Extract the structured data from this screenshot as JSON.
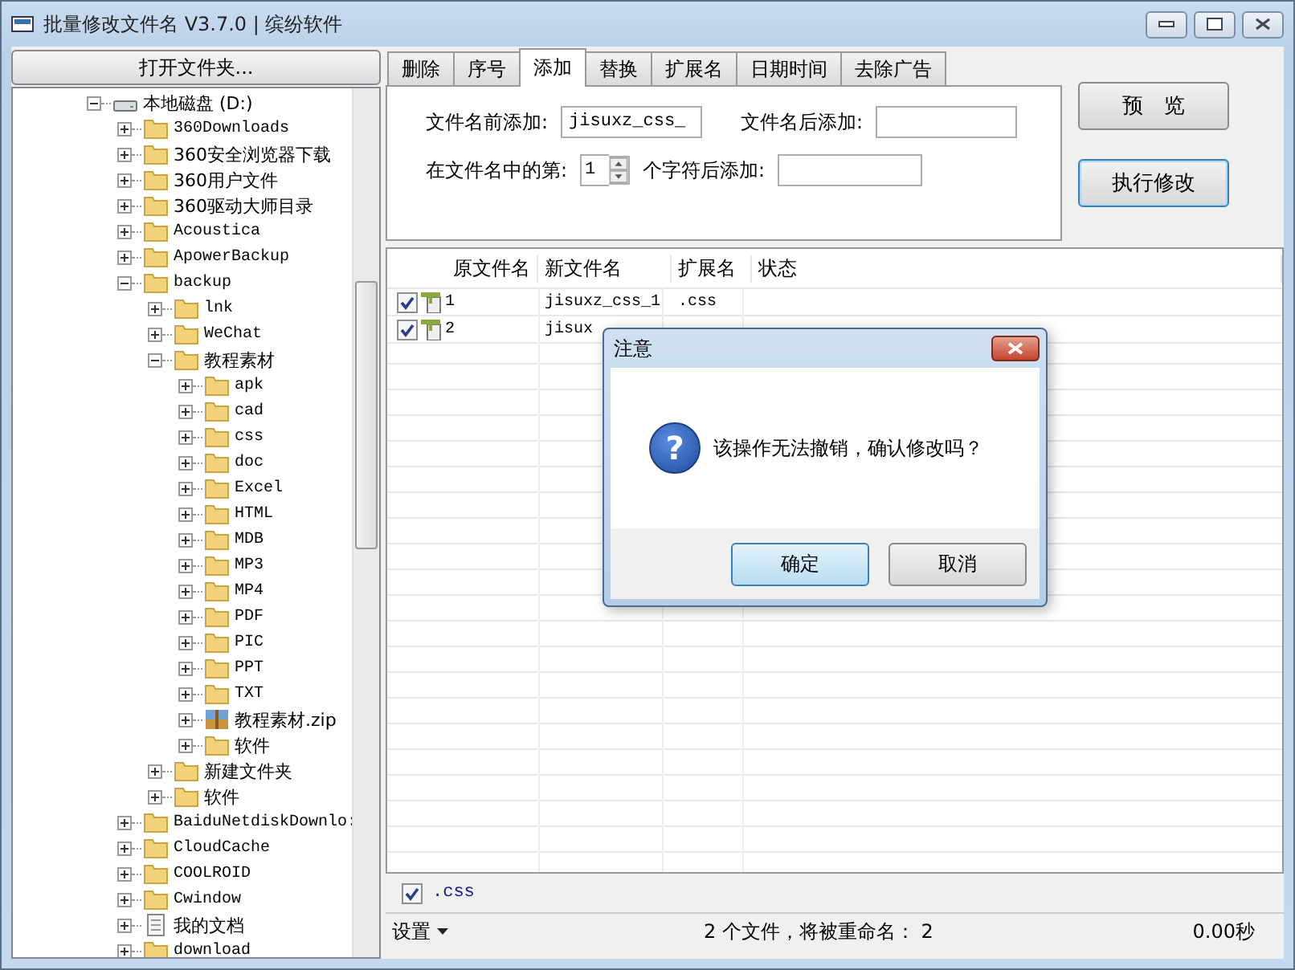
{
  "window": {
    "title": "批量修改文件名 V3.7.0 | 缤纷软件"
  },
  "open_folder_button": "打开文件夹...",
  "tree": [
    {
      "label": "本地磁盘 (D:)",
      "kind": "drive",
      "expanded": true,
      "children": [
        {
          "label": "360Downloads",
          "kind": "folder",
          "expanded": false
        },
        {
          "label": "360安全浏览器下载",
          "kind": "folder",
          "expanded": false
        },
        {
          "label": "360用户文件",
          "kind": "folder",
          "expanded": false
        },
        {
          "label": "360驱动大师目录",
          "kind": "folder",
          "expanded": false
        },
        {
          "label": "Acoustica",
          "kind": "folder",
          "expanded": false
        },
        {
          "label": "ApowerBackup",
          "kind": "folder",
          "expanded": false
        },
        {
          "label": "backup",
          "kind": "folder",
          "expanded": true,
          "children": [
            {
              "label": "lnk",
              "kind": "folder",
              "expanded": false
            },
            {
              "label": "WeChat",
              "kind": "folder",
              "expanded": false
            },
            {
              "label": "教程素材",
              "kind": "folder",
              "expanded": true,
              "children": [
                {
                  "label": "apk",
                  "kind": "folder",
                  "expanded": false
                },
                {
                  "label": "cad",
                  "kind": "folder",
                  "expanded": false
                },
                {
                  "label": "css",
                  "kind": "folder",
                  "expanded": false
                },
                {
                  "label": "doc",
                  "kind": "folder",
                  "expanded": false
                },
                {
                  "label": "Excel",
                  "kind": "folder",
                  "expanded": false
                },
                {
                  "label": "HTML",
                  "kind": "folder",
                  "expanded": false
                },
                {
                  "label": "MDB",
                  "kind": "folder",
                  "expanded": false
                },
                {
                  "label": "MP3",
                  "kind": "folder",
                  "expanded": false
                },
                {
                  "label": "MP4",
                  "kind": "folder",
                  "expanded": false
                },
                {
                  "label": "PDF",
                  "kind": "folder",
                  "expanded": false
                },
                {
                  "label": "PIC",
                  "kind": "folder",
                  "expanded": false
                },
                {
                  "label": "PPT",
                  "kind": "folder",
                  "expanded": false
                },
                {
                  "label": "TXT",
                  "kind": "folder",
                  "expanded": false
                },
                {
                  "label": "教程素材.zip",
                  "kind": "archive",
                  "expanded": false
                },
                {
                  "label": "软件",
                  "kind": "folder",
                  "expanded": false
                }
              ]
            },
            {
              "label": "新建文件夹",
              "kind": "folder",
              "expanded": false
            },
            {
              "label": "软件",
              "kind": "folder",
              "expanded": false
            }
          ]
        },
        {
          "label": "BaiduNetdiskDownlo:",
          "kind": "folder",
          "expanded": false
        },
        {
          "label": "CloudCache",
          "kind": "folder",
          "expanded": false
        },
        {
          "label": "COOLROID",
          "kind": "folder",
          "expanded": false
        },
        {
          "label": "Cwindow",
          "kind": "folder",
          "expanded": false
        },
        {
          "label": "我的文档",
          "kind": "document",
          "expanded": false
        },
        {
          "label": "download",
          "kind": "folder",
          "expanded": false
        }
      ]
    }
  ],
  "tabs": [
    {
      "label": "删除",
      "selected": false
    },
    {
      "label": "序号",
      "selected": false
    },
    {
      "label": "添加",
      "selected": true
    },
    {
      "label": "替换",
      "selected": false
    },
    {
      "label": "扩展名",
      "selected": false
    },
    {
      "label": "日期时间",
      "selected": false
    },
    {
      "label": "去除广告",
      "selected": false
    }
  ],
  "add_panel": {
    "prefix_label": "文件名前添加:",
    "prefix_value": "jisuxz_css_",
    "suffix_label": "文件名后添加:",
    "position_label": "在文件名中的第:",
    "position_value": "1",
    "after_label": "个字符后添加:"
  },
  "buttons": [
    {
      "label": "预　览",
      "selected": false
    },
    {
      "label": "执行修改",
      "selected": true
    }
  ],
  "table": {
    "columns": [
      "原文件名",
      "新文件名",
      "扩展名",
      "状态"
    ],
    "rows": [
      {
        "checked": true,
        "original": "1",
        "new": "jisuxz_css_1",
        "ext": ".css"
      },
      {
        "checked": true,
        "original": "2",
        "new": "jisux"
      }
    ]
  },
  "filter": {
    "checked": true,
    "label": ".css"
  },
  "status_bar": {
    "menu": "设置",
    "message": "2 个文件，将被重命名： 2",
    "time": "0.00秒"
  },
  "dialog": {
    "title": "注意",
    "icon_glyph": "?",
    "message": "该操作无法撤销，确认修改吗？",
    "buttons": [
      {
        "label": "确定",
        "selected": true
      },
      {
        "label": "取消",
        "selected": false
      }
    ]
  }
}
